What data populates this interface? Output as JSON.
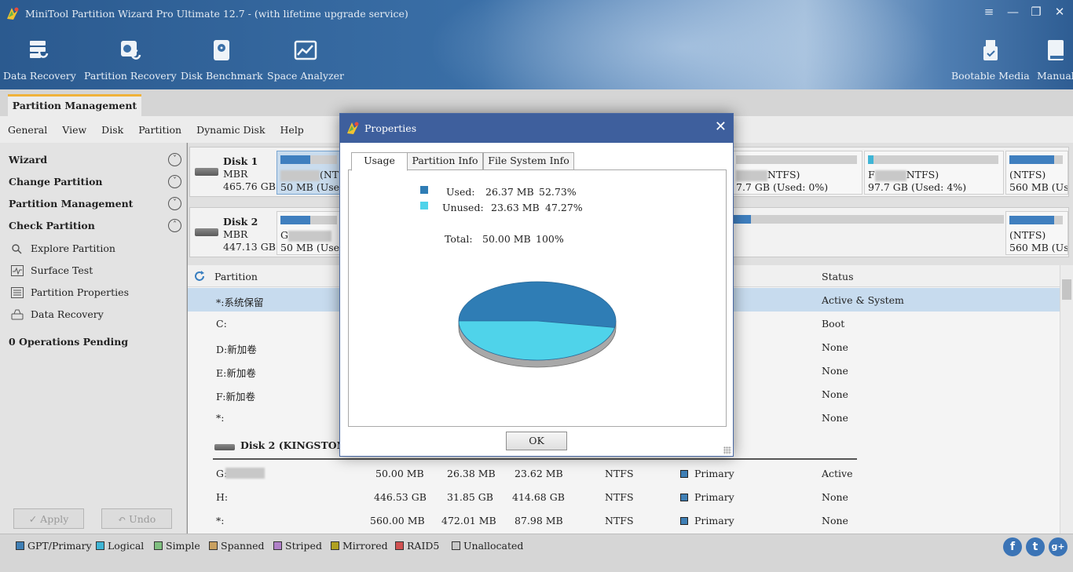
{
  "window": {
    "title": "MiniTool Partition Wizard Pro Ultimate 12.7 - (with lifetime upgrade service)",
    "controls": [
      "≡",
      "—",
      "❐",
      "✕"
    ]
  },
  "toolbar": {
    "data_recovery": "Data Recovery",
    "partition_recovery": "Partition Recovery",
    "disk_benchmark": "Disk Benchmark",
    "space_analyzer": "Space Analyzer",
    "bootable_media": "Bootable Media",
    "manual": "Manual"
  },
  "main_tab": "Partition Management",
  "menu": [
    "General",
    "View",
    "Disk",
    "Partition",
    "Dynamic Disk",
    "Help"
  ],
  "sidebar": {
    "sections": [
      {
        "label": "Wizard",
        "toggle": "˅"
      },
      {
        "label": "Change Partition",
        "toggle": "˅"
      },
      {
        "label": "Partition Management",
        "toggle": "˅"
      },
      {
        "label": "Check Partition",
        "toggle": "˄"
      }
    ],
    "items": [
      "Explore Partition",
      "Surface Test",
      "Partition Properties",
      "Data Recovery"
    ],
    "pending": "0 Operations Pending",
    "apply": "✓ Apply",
    "undo": "↶ Undo"
  },
  "disks": [
    {
      "name": "Disk 1",
      "type": "MBR",
      "size": "465.76 GB",
      "p1_suffix": "(NT",
      "p1_detail": "50 MB (Used",
      "p2_suffix": "NTFS)",
      "p2_detail": "7.7 GB (Used: 0%)",
      "p3_prefix": "F",
      "p3_suffix": "NTFS)",
      "p3_detail": "97.7 GB (Used: 4%)",
      "p4_fs": "(NTFS)",
      "p4_detail": "560 MB (Use"
    },
    {
      "name": "Disk 2",
      "type": "MBR",
      "size": "447.13 GB",
      "p1_prefix": "G",
      "p1_detail": "50 MB (Used",
      "p4_fs": "(NTFS)",
      "p4_detail": "560 MB (Use"
    }
  ],
  "list": {
    "header_partition": "Partition",
    "header_status": "Status",
    "disk1_rows": [
      {
        "name": "*:系统保留",
        "status": "Active & System"
      },
      {
        "name": "C:",
        "status": "Boot"
      },
      {
        "name": "D:新加卷",
        "status": "None"
      },
      {
        "name": "E:新加卷",
        "status": "None"
      },
      {
        "name": "F:新加卷",
        "status": "None"
      },
      {
        "name": "*:",
        "status": "None"
      }
    ],
    "disk2_header": "Disk 2 (KINGSTON SA",
    "disk2_rows": [
      {
        "name": "G:",
        "capacity": "50.00 MB",
        "used": "26.38 MB",
        "unused": "23.62 MB",
        "fs": "NTFS",
        "type": "Primary",
        "status": "Active"
      },
      {
        "name": "H:",
        "capacity": "446.53 GB",
        "used": "31.85 GB",
        "unused": "414.68 GB",
        "fs": "NTFS",
        "type": "Primary",
        "status": "None"
      },
      {
        "name": "*:",
        "capacity": "560.00 MB",
        "used": "472.01 MB",
        "unused": "87.98 MB",
        "fs": "NTFS",
        "type": "Primary",
        "status": "None"
      }
    ]
  },
  "legend": [
    {
      "label": "GPT/Primary",
      "color": "#3f7fb5"
    },
    {
      "label": "Logical",
      "color": "#3fb5d5"
    },
    {
      "label": "Simple",
      "color": "#7fbf7f"
    },
    {
      "label": "Spanned",
      "color": "#c8a060"
    },
    {
      "label": "Striped",
      "color": "#b080c8"
    },
    {
      "label": "Mirrored",
      "color": "#b0a020"
    },
    {
      "label": "RAID5",
      "color": "#d05050"
    },
    {
      "label": "Unallocated",
      "color": "#c8c8c8"
    }
  ],
  "social": {
    "facebook": "f",
    "twitter": "t",
    "google": "g+"
  },
  "dialog": {
    "title": "Properties",
    "close": "✕",
    "tabs": [
      "Usage",
      "Partition Info",
      "File System Info"
    ],
    "used_label": "Used:",
    "used_value": "26.37 MB",
    "used_pct": "52.73%",
    "unused_label": "Unused:",
    "unused_value": "23.63 MB",
    "unused_pct": "47.27%",
    "total_label": "Total:",
    "total_value": "50.00 MB",
    "total_pct": "100%",
    "ok": "OK",
    "colors": {
      "used": "#2f7db5",
      "unused": "#4fd3ea"
    }
  },
  "chart_data": {
    "type": "pie",
    "categories": [
      "Used",
      "Unused"
    ],
    "values": [
      52.73,
      47.27
    ]
  }
}
